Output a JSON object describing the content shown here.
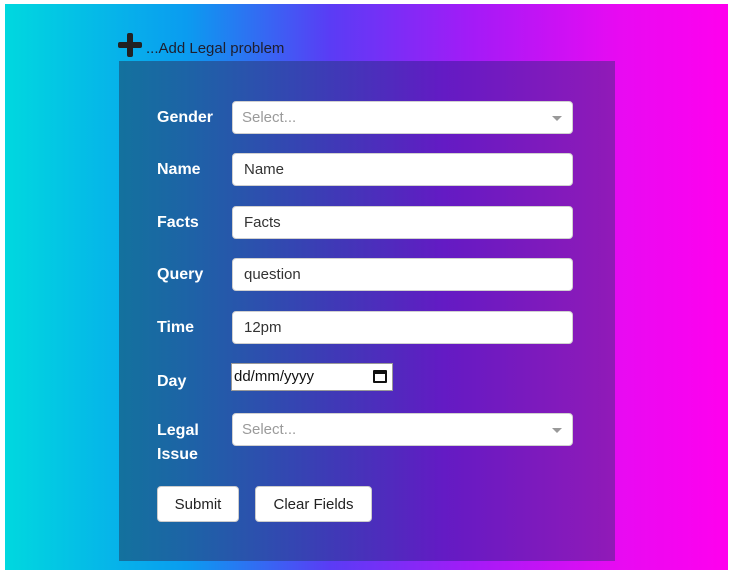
{
  "header": {
    "icon": "plus-icon",
    "title": "...Add Legal problem"
  },
  "form": {
    "gender": {
      "label": "Gender",
      "placeholder": "Select...",
      "icon": "chevron-down-icon"
    },
    "name": {
      "label": "Name",
      "value": "Name"
    },
    "facts": {
      "label": "Facts",
      "value": "Facts"
    },
    "query": {
      "label": "Query",
      "value": "question"
    },
    "time": {
      "label": "Time",
      "value": "12pm"
    },
    "day": {
      "label": "Day",
      "value": "dd/mm/yyyy",
      "icon": "calendar-icon"
    },
    "legal_issue": {
      "label_line1": "Legal",
      "label_line2": "Issue",
      "placeholder": "Select...",
      "icon": "chevron-down-icon"
    }
  },
  "buttons": {
    "submit": "Submit",
    "clear": "Clear Fields"
  }
}
